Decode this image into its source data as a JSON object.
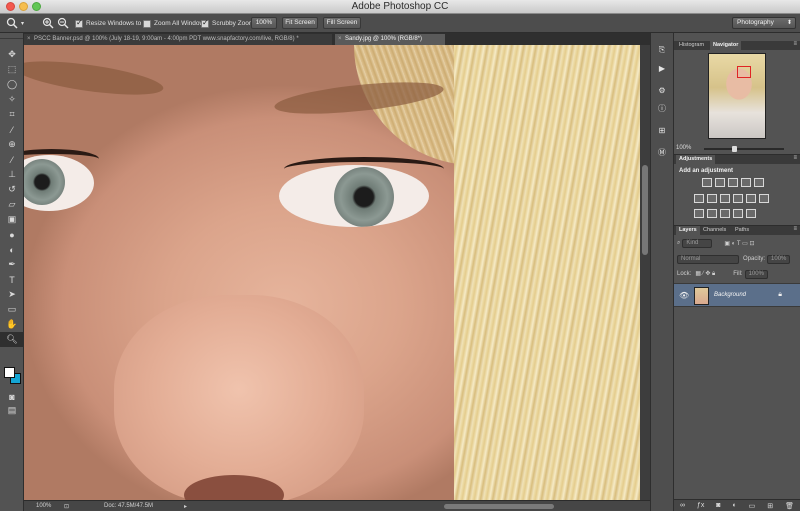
{
  "window": {
    "title": "Adobe Photoshop CC"
  },
  "options_bar": {
    "resize_windows_label": "Resize Windows to Fit",
    "zoom_all_label": "Zoom All Windows",
    "scrubby_zoom_label": "Scrubby Zoom",
    "zoom_100_label": "100%",
    "fit_screen_label": "Fit Screen",
    "fill_screen_label": "Fill Screen",
    "resize_windows_checked": true,
    "zoom_all_checked": false,
    "scrubby_checked": true,
    "workspace": "Photography"
  },
  "doc_tabs": [
    {
      "label": "PSCC Banner.psd @ 100% (July 18-19, 9:00am - 4:00pm PDT www.snapfactory.com/live, RGB/8) *",
      "active": false
    },
    {
      "label": "Sandy.jpg @ 100% (RGB/8*)",
      "active": true
    }
  ],
  "status_bar": {
    "zoom": "100%",
    "doc": "Doc: 47.5M/47.5M"
  },
  "panels": {
    "nav_tabs": [
      "Histogram",
      "Navigator"
    ],
    "nav_zoom": "100%",
    "adjustments_tab": "Adjustments",
    "adjustments_title": "Add an adjustment",
    "layer_tabs": [
      "Layers",
      "Channels",
      "Paths"
    ],
    "kind_label": "Kind",
    "blend_mode": "Normal",
    "opacity_label": "Opacity:",
    "opacity_value": "100%",
    "lock_label": "Lock:",
    "fill_label": "Fill:",
    "fill_value": "100%",
    "layer_name": "Background"
  },
  "colors": {
    "foreground": "#ffffff",
    "background": "#14a6d5",
    "layer_highlight": "#5b6f8a"
  }
}
